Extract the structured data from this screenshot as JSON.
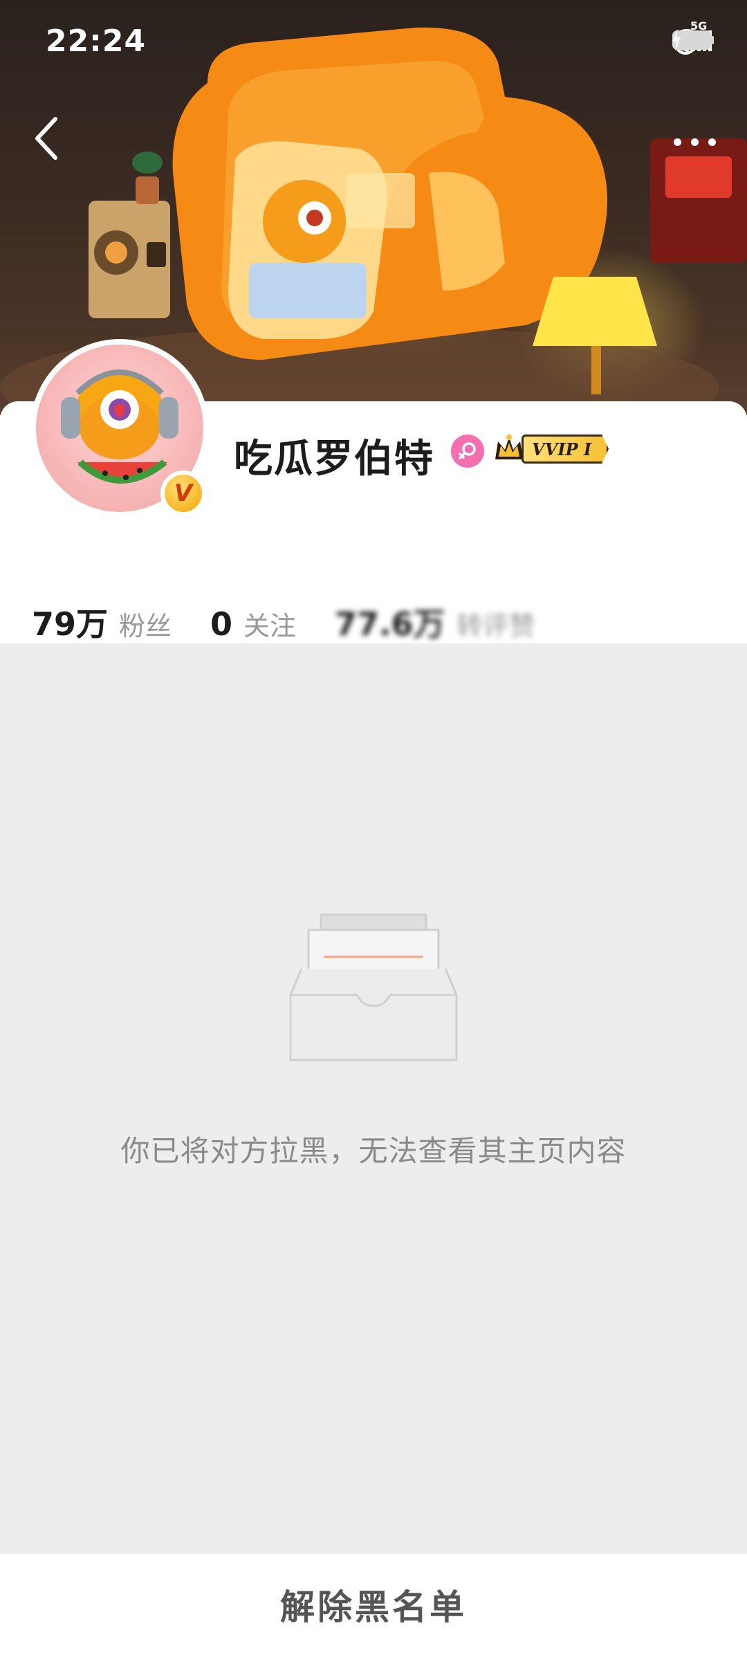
{
  "status_bar": {
    "time": "22:24",
    "network": "5G",
    "icons": [
      "alarm-icon",
      "moon-icon",
      "signal-icon",
      "wifi-icon",
      "battery-icon",
      "charging-icon"
    ]
  },
  "nav": {
    "back_icon": "chevron-left-icon",
    "more_icon": "more-dots-icon"
  },
  "profile": {
    "username": "吃瓜罗伯特",
    "gender_icon": "female-icon",
    "gender_color": "#f36fb0",
    "vip_label": "VVIP I",
    "verified_icon": "v-verified-icon"
  },
  "stats": [
    {
      "value": "79万",
      "label": "粉丝"
    },
    {
      "value": "0",
      "label": "关注"
    },
    {
      "value": "77.6万",
      "label": "转评赞"
    }
  ],
  "empty_state": {
    "icon": "empty-inbox-icon",
    "message": "你已将对方拉黑，无法查看其主页内容"
  },
  "bottom": {
    "unblock_label": "解除黑名单"
  },
  "colors": {
    "banner_orange": "#f58a14",
    "page_bg": "#ededed",
    "accent_line": "#f4a58a"
  }
}
